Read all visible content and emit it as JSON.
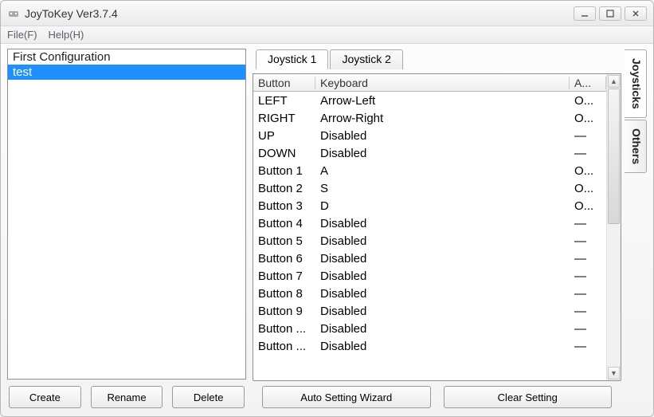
{
  "window": {
    "title": "JoyToKey Ver3.7.4"
  },
  "menubar": {
    "file": "File(F)",
    "help": "Help(H)"
  },
  "configs": {
    "items": [
      {
        "label": "First Configuration",
        "selected": false
      },
      {
        "label": "test",
        "selected": true
      }
    ]
  },
  "left_buttons": {
    "create": "Create",
    "rename": "Rename",
    "delete": "Delete"
  },
  "joystick_tabs": {
    "tab1": "Joystick 1",
    "tab2": "Joystick 2"
  },
  "table": {
    "headers": {
      "button": "Button",
      "keyboard": "Keyboard",
      "auto": "A..."
    },
    "rows": [
      {
        "button": "LEFT",
        "keyboard": "Arrow-Left",
        "auto": "O..."
      },
      {
        "button": "RIGHT",
        "keyboard": "Arrow-Right",
        "auto": "O..."
      },
      {
        "button": "UP",
        "keyboard": "Disabled",
        "auto": "—"
      },
      {
        "button": "DOWN",
        "keyboard": "Disabled",
        "auto": "—"
      },
      {
        "button": "Button 1",
        "keyboard": "A",
        "auto": "O..."
      },
      {
        "button": "Button 2",
        "keyboard": "S",
        "auto": "O..."
      },
      {
        "button": "Button 3",
        "keyboard": "D",
        "auto": "O..."
      },
      {
        "button": "Button 4",
        "keyboard": "Disabled",
        "auto": "—"
      },
      {
        "button": "Button 5",
        "keyboard": "Disabled",
        "auto": "—"
      },
      {
        "button": "Button 6",
        "keyboard": "Disabled",
        "auto": "—"
      },
      {
        "button": "Button 7",
        "keyboard": "Disabled",
        "auto": "—"
      },
      {
        "button": "Button 8",
        "keyboard": "Disabled",
        "auto": "—"
      },
      {
        "button": "Button 9",
        "keyboard": "Disabled",
        "auto": "—"
      },
      {
        "button": "Button ...",
        "keyboard": "Disabled",
        "auto": "—"
      },
      {
        "button": "Button ...",
        "keyboard": "Disabled",
        "auto": "—"
      }
    ]
  },
  "right_buttons": {
    "wizard": "Auto Setting Wizard",
    "clear": "Clear Setting"
  },
  "sidetabs": {
    "joysticks": "Joysticks",
    "others": "Others"
  }
}
